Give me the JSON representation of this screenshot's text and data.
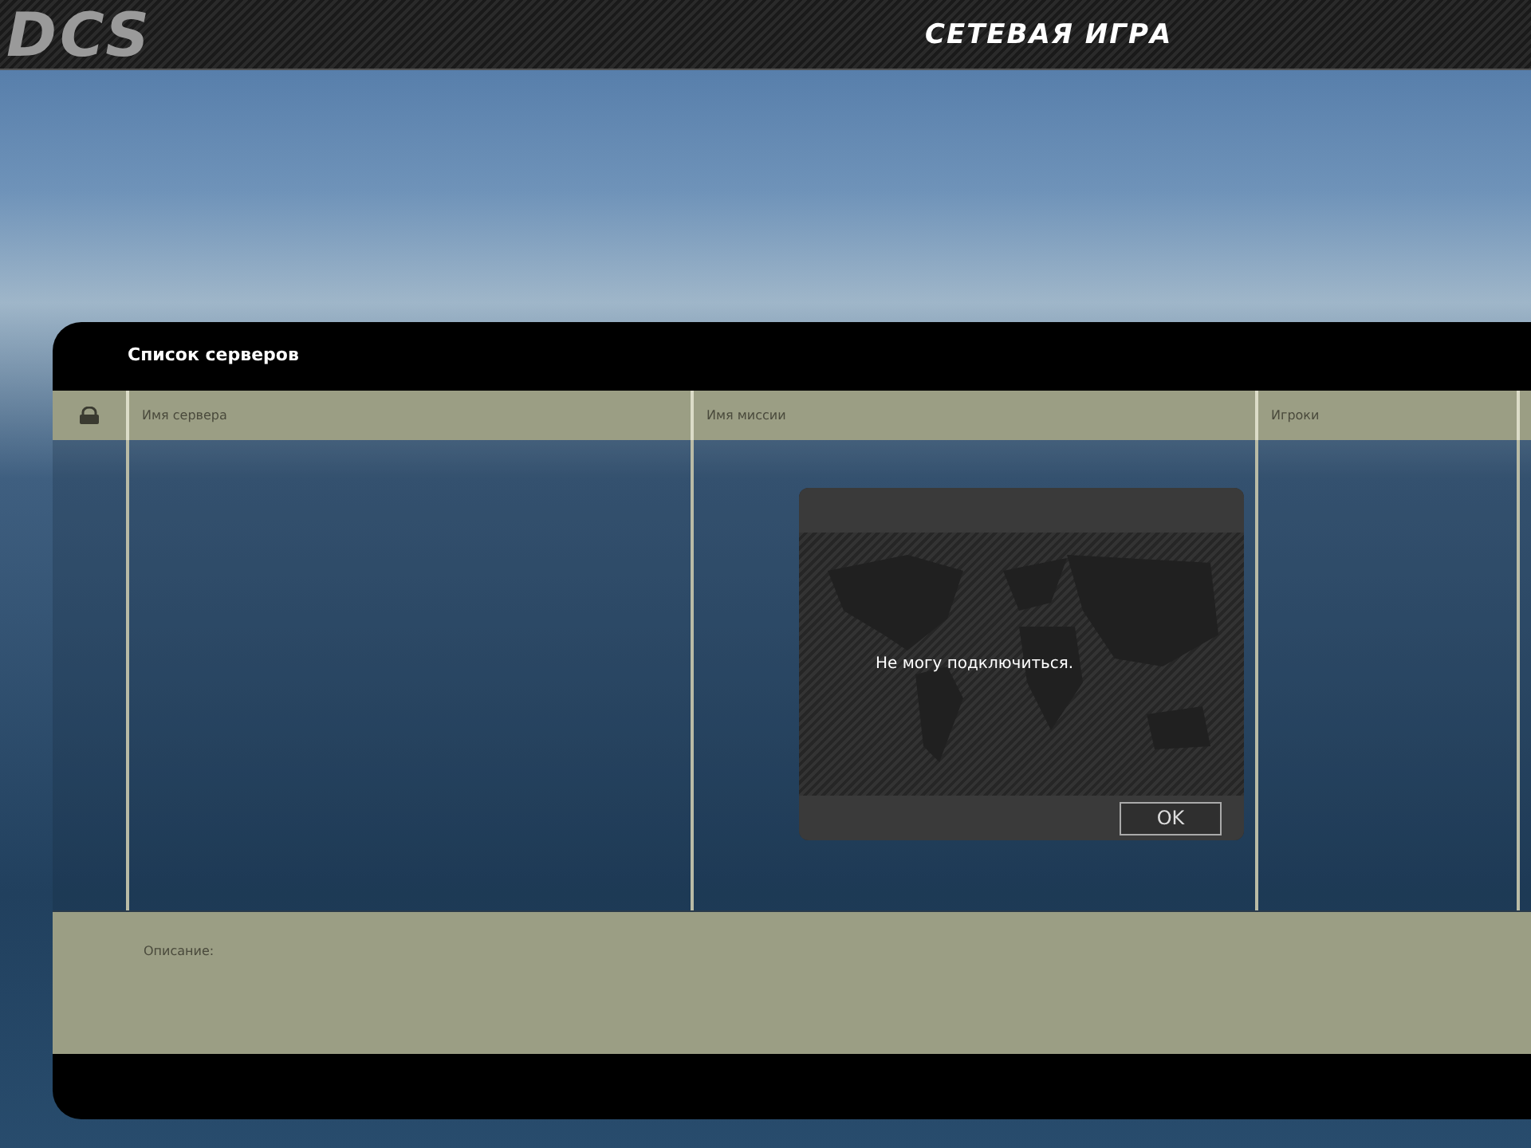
{
  "header": {
    "logo": "DCS",
    "title": "СЕТЕВАЯ ИГРА"
  },
  "server_list": {
    "title": "Список серверов",
    "columns": [
      {
        "kind": "icon"
      },
      {
        "kind": "text",
        "label": "Имя сервера"
      },
      {
        "kind": "text",
        "label": "Имя миссии"
      },
      {
        "kind": "text",
        "label": "Игроки"
      }
    ],
    "description_label": "Описание:"
  },
  "dialog": {
    "message": "Не могу подключиться.",
    "buttons": [
      "OK"
    ]
  }
}
